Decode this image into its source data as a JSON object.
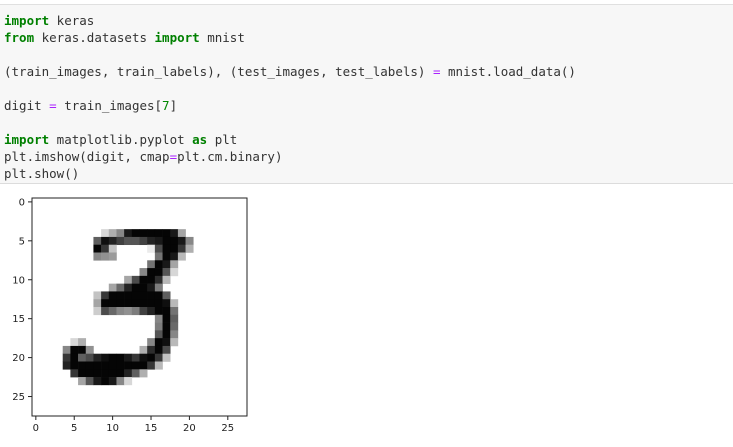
{
  "code_lines": [
    [
      {
        "t": "import",
        "c": "kw"
      },
      {
        "t": " keras",
        "c": ""
      }
    ],
    [
      {
        "t": "from",
        "c": "kw"
      },
      {
        "t": " keras.datasets ",
        "c": ""
      },
      {
        "t": "import",
        "c": "kw"
      },
      {
        "t": " mnist",
        "c": ""
      }
    ],
    [],
    [
      {
        "t": "(train_images, train_labels), (test_images, test_labels) ",
        "c": ""
      },
      {
        "t": "=",
        "c": "op"
      },
      {
        "t": " mnist.load_data()",
        "c": ""
      }
    ],
    [],
    [
      {
        "t": "digit ",
        "c": ""
      },
      {
        "t": "=",
        "c": "op"
      },
      {
        "t": " train_images[",
        "c": ""
      },
      {
        "t": "7",
        "c": "num"
      },
      {
        "t": "]",
        "c": ""
      }
    ],
    [],
    [
      {
        "t": "import",
        "c": "kw"
      },
      {
        "t": " matplotlib.pyplot ",
        "c": ""
      },
      {
        "t": "as",
        "c": "kw"
      },
      {
        "t": " plt",
        "c": ""
      }
    ],
    [
      {
        "t": "plt.imshow(digit, cmap",
        "c": ""
      },
      {
        "t": "=",
        "c": "op"
      },
      {
        "t": "plt.cm.binary)",
        "c": ""
      }
    ],
    [
      {
        "t": "plt.show()",
        "c": ""
      }
    ]
  ],
  "chart_data": {
    "type": "heatmap",
    "colormap": "binary",
    "xlim": [
      -0.5,
      27.5
    ],
    "ylim": [
      27.5,
      -0.5
    ],
    "xticks": [
      0,
      5,
      10,
      15,
      20,
      25
    ],
    "yticks": [
      0,
      5,
      10,
      15,
      20,
      25
    ],
    "xticklabels": [
      "0",
      "5",
      "10",
      "15",
      "20",
      "25"
    ],
    "yticklabels": [
      "0",
      "5",
      "10",
      "15",
      "20",
      "25"
    ],
    "pixels": [
      {
        "row": 4,
        "col": 9,
        "v": 40
      },
      {
        "row": 4,
        "col": 10,
        "v": 80
      },
      {
        "row": 4,
        "col": 11,
        "v": 120
      },
      {
        "row": 4,
        "col": 12,
        "v": 230
      },
      {
        "row": 4,
        "col": 13,
        "v": 250
      },
      {
        "row": 4,
        "col": 14,
        "v": 250
      },
      {
        "row": 4,
        "col": 15,
        "v": 250
      },
      {
        "row": 4,
        "col": 16,
        "v": 250
      },
      {
        "row": 4,
        "col": 17,
        "v": 250
      },
      {
        "row": 4,
        "col": 18,
        "v": 230
      },
      {
        "row": 4,
        "col": 19,
        "v": 90
      },
      {
        "row": 5,
        "col": 8,
        "v": 160
      },
      {
        "row": 5,
        "col": 9,
        "v": 240
      },
      {
        "row": 5,
        "col": 10,
        "v": 220
      },
      {
        "row": 5,
        "col": 11,
        "v": 190
      },
      {
        "row": 5,
        "col": 12,
        "v": 170
      },
      {
        "row": 5,
        "col": 13,
        "v": 170
      },
      {
        "row": 5,
        "col": 14,
        "v": 190
      },
      {
        "row": 5,
        "col": 15,
        "v": 220
      },
      {
        "row": 5,
        "col": 16,
        "v": 230
      },
      {
        "row": 5,
        "col": 17,
        "v": 250
      },
      {
        "row": 5,
        "col": 18,
        "v": 250
      },
      {
        "row": 5,
        "col": 19,
        "v": 230
      },
      {
        "row": 5,
        "col": 20,
        "v": 120
      },
      {
        "row": 6,
        "col": 8,
        "v": 250
      },
      {
        "row": 6,
        "col": 9,
        "v": 200
      },
      {
        "row": 6,
        "col": 10,
        "v": 60
      },
      {
        "row": 6,
        "col": 15,
        "v": 20
      },
      {
        "row": 6,
        "col": 16,
        "v": 180
      },
      {
        "row": 6,
        "col": 17,
        "v": 250
      },
      {
        "row": 6,
        "col": 18,
        "v": 250
      },
      {
        "row": 6,
        "col": 19,
        "v": 200
      },
      {
        "row": 6,
        "col": 20,
        "v": 80
      },
      {
        "row": 7,
        "col": 8,
        "v": 120
      },
      {
        "row": 7,
        "col": 9,
        "v": 110
      },
      {
        "row": 7,
        "col": 10,
        "v": 100
      },
      {
        "row": 7,
        "col": 16,
        "v": 140
      },
      {
        "row": 7,
        "col": 17,
        "v": 250
      },
      {
        "row": 7,
        "col": 18,
        "v": 230
      },
      {
        "row": 7,
        "col": 19,
        "v": 70
      },
      {
        "row": 8,
        "col": 15,
        "v": 140
      },
      {
        "row": 8,
        "col": 16,
        "v": 250
      },
      {
        "row": 8,
        "col": 17,
        "v": 230
      },
      {
        "row": 8,
        "col": 18,
        "v": 90
      },
      {
        "row": 9,
        "col": 14,
        "v": 120
      },
      {
        "row": 9,
        "col": 15,
        "v": 250
      },
      {
        "row": 9,
        "col": 16,
        "v": 250
      },
      {
        "row": 9,
        "col": 17,
        "v": 170
      },
      {
        "row": 9,
        "col": 18,
        "v": 40
      },
      {
        "row": 10,
        "col": 12,
        "v": 90
      },
      {
        "row": 10,
        "col": 13,
        "v": 180
      },
      {
        "row": 10,
        "col": 14,
        "v": 250
      },
      {
        "row": 10,
        "col": 15,
        "v": 250
      },
      {
        "row": 10,
        "col": 16,
        "v": 210
      },
      {
        "row": 10,
        "col": 17,
        "v": 70
      },
      {
        "row": 11,
        "col": 10,
        "v": 90
      },
      {
        "row": 11,
        "col": 11,
        "v": 150
      },
      {
        "row": 11,
        "col": 12,
        "v": 220
      },
      {
        "row": 11,
        "col": 13,
        "v": 250
      },
      {
        "row": 11,
        "col": 14,
        "v": 250
      },
      {
        "row": 11,
        "col": 15,
        "v": 230
      },
      {
        "row": 11,
        "col": 16,
        "v": 130
      },
      {
        "row": 12,
        "col": 8,
        "v": 60
      },
      {
        "row": 12,
        "col": 9,
        "v": 200
      },
      {
        "row": 12,
        "col": 10,
        "v": 250
      },
      {
        "row": 12,
        "col": 11,
        "v": 250
      },
      {
        "row": 12,
        "col": 12,
        "v": 250
      },
      {
        "row": 12,
        "col": 13,
        "v": 250
      },
      {
        "row": 12,
        "col": 14,
        "v": 250
      },
      {
        "row": 12,
        "col": 15,
        "v": 250
      },
      {
        "row": 12,
        "col": 16,
        "v": 250
      },
      {
        "row": 12,
        "col": 17,
        "v": 160
      },
      {
        "row": 13,
        "col": 8,
        "v": 90
      },
      {
        "row": 13,
        "col": 9,
        "v": 250
      },
      {
        "row": 13,
        "col": 10,
        "v": 250
      },
      {
        "row": 13,
        "col": 11,
        "v": 250
      },
      {
        "row": 13,
        "col": 12,
        "v": 250
      },
      {
        "row": 13,
        "col": 13,
        "v": 250
      },
      {
        "row": 13,
        "col": 14,
        "v": 250
      },
      {
        "row": 13,
        "col": 15,
        "v": 250
      },
      {
        "row": 13,
        "col": 16,
        "v": 250
      },
      {
        "row": 13,
        "col": 17,
        "v": 240
      },
      {
        "row": 13,
        "col": 18,
        "v": 70
      },
      {
        "row": 14,
        "col": 8,
        "v": 50
      },
      {
        "row": 14,
        "col": 9,
        "v": 180
      },
      {
        "row": 14,
        "col": 10,
        "v": 150
      },
      {
        "row": 14,
        "col": 11,
        "v": 120
      },
      {
        "row": 14,
        "col": 12,
        "v": 110
      },
      {
        "row": 14,
        "col": 13,
        "v": 130
      },
      {
        "row": 14,
        "col": 14,
        "v": 190
      },
      {
        "row": 14,
        "col": 15,
        "v": 220
      },
      {
        "row": 14,
        "col": 16,
        "v": 250
      },
      {
        "row": 14,
        "col": 17,
        "v": 250
      },
      {
        "row": 14,
        "col": 18,
        "v": 140
      },
      {
        "row": 15,
        "col": 16,
        "v": 120
      },
      {
        "row": 15,
        "col": 17,
        "v": 250
      },
      {
        "row": 15,
        "col": 18,
        "v": 160
      },
      {
        "row": 16,
        "col": 16,
        "v": 130
      },
      {
        "row": 16,
        "col": 17,
        "v": 250
      },
      {
        "row": 16,
        "col": 18,
        "v": 150
      },
      {
        "row": 17,
        "col": 16,
        "v": 170
      },
      {
        "row": 17,
        "col": 17,
        "v": 250
      },
      {
        "row": 17,
        "col": 18,
        "v": 120
      },
      {
        "row": 18,
        "col": 5,
        "v": 40
      },
      {
        "row": 18,
        "col": 6,
        "v": 80
      },
      {
        "row": 18,
        "col": 15,
        "v": 120
      },
      {
        "row": 18,
        "col": 16,
        "v": 250
      },
      {
        "row": 18,
        "col": 17,
        "v": 240
      },
      {
        "row": 18,
        "col": 18,
        "v": 70
      },
      {
        "row": 19,
        "col": 4,
        "v": 120
      },
      {
        "row": 19,
        "col": 5,
        "v": 250
      },
      {
        "row": 19,
        "col": 6,
        "v": 250
      },
      {
        "row": 19,
        "col": 7,
        "v": 110
      },
      {
        "row": 19,
        "col": 14,
        "v": 80
      },
      {
        "row": 19,
        "col": 15,
        "v": 210
      },
      {
        "row": 19,
        "col": 16,
        "v": 250
      },
      {
        "row": 19,
        "col": 17,
        "v": 180
      },
      {
        "row": 20,
        "col": 4,
        "v": 200
      },
      {
        "row": 20,
        "col": 5,
        "v": 250
      },
      {
        "row": 20,
        "col": 6,
        "v": 160
      },
      {
        "row": 20,
        "col": 7,
        "v": 180
      },
      {
        "row": 20,
        "col": 8,
        "v": 220
      },
      {
        "row": 20,
        "col": 9,
        "v": 240
      },
      {
        "row": 20,
        "col": 10,
        "v": 250
      },
      {
        "row": 20,
        "col": 11,
        "v": 250
      },
      {
        "row": 20,
        "col": 12,
        "v": 230
      },
      {
        "row": 20,
        "col": 13,
        "v": 200
      },
      {
        "row": 20,
        "col": 14,
        "v": 240
      },
      {
        "row": 20,
        "col": 15,
        "v": 250
      },
      {
        "row": 20,
        "col": 16,
        "v": 200
      },
      {
        "row": 20,
        "col": 17,
        "v": 60
      },
      {
        "row": 21,
        "col": 4,
        "v": 220
      },
      {
        "row": 21,
        "col": 5,
        "v": 250
      },
      {
        "row": 21,
        "col": 6,
        "v": 250
      },
      {
        "row": 21,
        "col": 7,
        "v": 250
      },
      {
        "row": 21,
        "col": 8,
        "v": 250
      },
      {
        "row": 21,
        "col": 9,
        "v": 250
      },
      {
        "row": 21,
        "col": 10,
        "v": 250
      },
      {
        "row": 21,
        "col": 11,
        "v": 250
      },
      {
        "row": 21,
        "col": 12,
        "v": 250
      },
      {
        "row": 21,
        "col": 13,
        "v": 250
      },
      {
        "row": 21,
        "col": 14,
        "v": 250
      },
      {
        "row": 21,
        "col": 15,
        "v": 200
      },
      {
        "row": 21,
        "col": 16,
        "v": 70
      },
      {
        "row": 22,
        "col": 5,
        "v": 200
      },
      {
        "row": 22,
        "col": 6,
        "v": 250
      },
      {
        "row": 22,
        "col": 7,
        "v": 250
      },
      {
        "row": 22,
        "col": 8,
        "v": 250
      },
      {
        "row": 22,
        "col": 9,
        "v": 250
      },
      {
        "row": 22,
        "col": 10,
        "v": 250
      },
      {
        "row": 22,
        "col": 11,
        "v": 250
      },
      {
        "row": 22,
        "col": 12,
        "v": 220
      },
      {
        "row": 22,
        "col": 13,
        "v": 160
      },
      {
        "row": 22,
        "col": 14,
        "v": 80
      },
      {
        "row": 23,
        "col": 6,
        "v": 90
      },
      {
        "row": 23,
        "col": 7,
        "v": 170
      },
      {
        "row": 23,
        "col": 8,
        "v": 230
      },
      {
        "row": 23,
        "col": 9,
        "v": 250
      },
      {
        "row": 23,
        "col": 10,
        "v": 230
      },
      {
        "row": 23,
        "col": 11,
        "v": 120
      },
      {
        "row": 23,
        "col": 12,
        "v": 40
      }
    ]
  }
}
